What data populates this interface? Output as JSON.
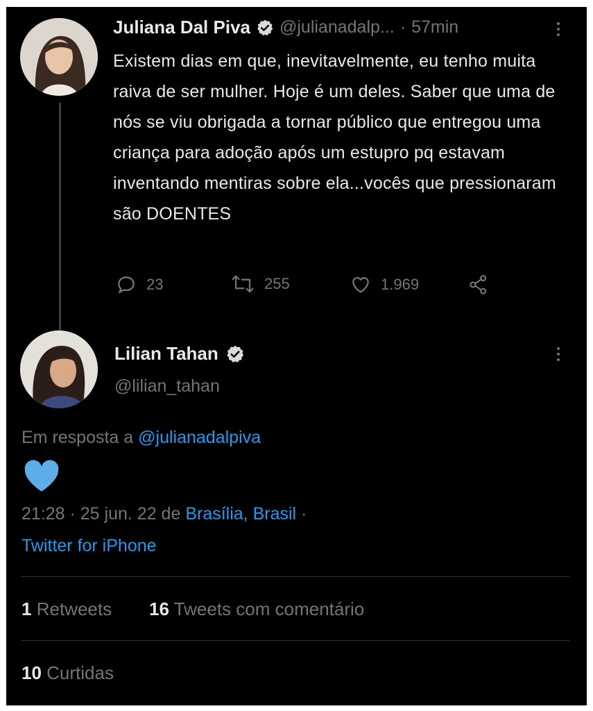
{
  "tweet": {
    "author": "Juliana Dal Piva",
    "handle": "@julianadalp...",
    "time_sep": "·",
    "time": "57min",
    "text": "Existem dias em que, inevitavelmente, eu tenho muita raiva de ser mulher. Hoje é um deles. Saber que uma de nós se viu obrigada a tornar público que entregou uma criança para adoção após um estupro pq estavam inventando mentiras sobre ela...vocês que pressionaram são DOENTES",
    "replies": "23",
    "retweets": "255",
    "likes": "1.969",
    "icons": [
      "verified-icon",
      "more-icon",
      "reply-icon",
      "retweet-icon",
      "like-icon",
      "share-icon"
    ]
  },
  "reply": {
    "author": "Lilian Tahan",
    "handle": "@lilian_tahan",
    "in_reply_prefix": "Em resposta a",
    "in_reply_handle": "@julianadalpiva",
    "body_emoji": "blue-heart",
    "timestamp": "21:28 · 25 jun. 22 de",
    "location": "Brasília, Brasil",
    "loc_sep": " ·",
    "source": "Twitter for iPhone",
    "stats": {
      "retweets_count": "1",
      "retweets_label": "Retweets",
      "quotes_count": "16",
      "quotes_label": "Tweets com comentário",
      "likes_count": "10",
      "likes_label": "Curtidas"
    }
  },
  "colors": {
    "background": "#000000",
    "text": "#e7e9ea",
    "muted": "#71767b",
    "link": "#1d9bf0",
    "heart": "#5daee8"
  }
}
